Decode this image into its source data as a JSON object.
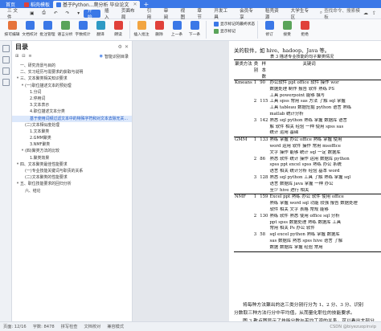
{
  "titlebar": {
    "home": "首页",
    "tabs": [
      {
        "label": "稻壳模板",
        "icon_color": "#e0413a"
      },
      {
        "label": "基于Python...爬分析 毕业论文",
        "icon_color": "#3b78e7"
      }
    ],
    "new_tab": "+"
  },
  "menubar": {
    "items": [
      "三 文件",
      "",
      "",
      "",
      "",
      "",
      "开始",
      "插入",
      "页面布局",
      "引用",
      "审阅",
      "视图",
      "章节",
      "开发工具",
      "会员专享",
      "稻壳资源",
      "大学生专区"
    ],
    "active": "开始",
    "search": "查找命令、搜索模板"
  },
  "ribbon": {
    "buttons": [
      {
        "label": "按可编辑",
        "color": "#e6733a"
      },
      {
        "label": "文档校对",
        "color": "#3b78e7"
      },
      {
        "label": "批注管理",
        "color": "#3b78e7"
      },
      {
        "label": "语言分析",
        "color": "#5aa45a"
      },
      {
        "label": "字数统计",
        "color": "#3b78e7"
      },
      {
        "label": "翻译",
        "color": "#2f9ac4"
      },
      {
        "label": "朗读",
        "color": "#e0413a"
      },
      {
        "label": "插入批注",
        "color": "#f2a541"
      },
      {
        "label": "删除",
        "color": "#e0413a"
      },
      {
        "label": "上一条",
        "color": "#3b78e7"
      },
      {
        "label": "下一条",
        "color": "#3b78e7"
      }
    ],
    "group2": [
      "显示标记的最终状态",
      "显示标记"
    ],
    "group3": [
      "修订",
      "接受",
      "拒绝"
    ]
  },
  "toc": {
    "title": "目录",
    "smart": "智能识别目录",
    "items": [
      {
        "label": "一、研究背景与目的",
        "level": 1,
        "arrow": ""
      },
      {
        "label": "二、实习经历与需要求的获取与说明",
        "level": 1,
        "arrow": ""
      },
      {
        "label": "三、文本聚类相关知识要求",
        "level": 1,
        "arrow": "▾"
      },
      {
        "label": "(一)职位描述文本的预处理",
        "level": 2,
        "arrow": "▾"
      },
      {
        "label": "1.分词",
        "level": 3,
        "arrow": ""
      },
      {
        "label": "2.停用词",
        "level": 3,
        "arrow": ""
      },
      {
        "label": "3.文本表示",
        "level": 3,
        "arrow": ""
      },
      {
        "label": "4.职位描述文本分类",
        "level": 3,
        "arrow": ""
      },
      {
        "label": "基于使用词频过滤文本中的特殊字符和对文本去除无关...",
        "level": 3,
        "arrow": "",
        "selected": true
      },
      {
        "label": "(二)文本相似度处理",
        "level": 2,
        "arrow": ""
      },
      {
        "label": "1.文本聚类",
        "level": 3,
        "arrow": ""
      },
      {
        "label": "2.GMM聚类",
        "level": 3,
        "arrow": ""
      },
      {
        "label": "3.NMF聚类",
        "level": 3,
        "arrow": ""
      },
      {
        "label": "(四)聚类方法的比较",
        "level": 2,
        "arrow": "▾"
      },
      {
        "label": "1.聚类效果",
        "level": 3,
        "arrow": ""
      },
      {
        "label": "四、文本聚类最佳性能要求",
        "level": 1,
        "arrow": "▾"
      },
      {
        "label": "(一)专业技能关键词与职责的关系",
        "level": 2,
        "arrow": ""
      },
      {
        "label": "(二)文本聚类的性能要求",
        "level": 2,
        "arrow": ""
      },
      {
        "label": "五、职位技能要求的回归分析",
        "level": 1,
        "arrow": "▾"
      },
      {
        "label": "六、结论",
        "level": 2,
        "arrow": ""
      }
    ]
  },
  "document": {
    "intro": "关的软件，如 hive、hadoop、Java 等。",
    "caption": "表 3 描述专业技能的句子聚类情况",
    "table": {
      "headers": [
        "聚类方法",
        "类别",
        "样本数",
        "关键词"
      ],
      "rows": [
        {
          "method": "Kmeans",
          "cls": "1",
          "num": "90",
          "kw": [
            "办公软件 ppt office 软件 操作 wor",
            "数据处理 制作 报告 软件 熟练 PS",
            "工具 powerpoint 能够 撰写"
          ],
          "sep": true
        },
        {
          "method": "",
          "cls": "2",
          "num": "115",
          "kw": [
            "工具 spss 常用 sas 方法 了解 sql 掌握",
            "工具 tableau 数据挖掘 python 语言 熟练",
            "matlab 统计分析"
          ],
          "sep": false
        },
        {
          "method": "",
          "cls": "3",
          "num": "142",
          "kw": [
            "熟悉 sql python 熟练 掌握 数据库 语言",
            "解 软件 相关 经验 一种 使用 spss sas",
            "统计 运用 基础"
          ],
          "sep": false
        },
        {
          "method": "GMM",
          "cls": "1",
          "num": "133",
          "kw": [
            "熟练 掌握 办公 office 熟练 掌握 使用",
            "word 运用 软件 操作 常用 msoffice",
            "文字 操作 能够 统计 sql 一定 数据库"
          ],
          "sep": true
        },
        {
          "method": "",
          "cls": "2",
          "num": "86",
          "kw": [
            "熟悉 软件 统计 操作 运用 数据库 python",
            "spss ppt excel spss 熟练 办公 系统",
            "语言 相关 统计分析 经验 基本 word"
          ],
          "sep": false
        },
        {
          "method": "",
          "cls": "3",
          "num": "128",
          "kw": [
            "熟悉 sql python 工具 了解 熟练 掌握 sql",
            "语言 数据库 java 掌握 一种 办公",
            "至少 hive 进行 相关"
          ],
          "sep": false
        },
        {
          "method": "NMF",
          "cls": "1",
          "num": "159",
          "kw": [
            "Excel ppt 熟练 办公 软件 使用 office",
            "熟练 掌握 word sql 功能 较强 报告 数据处理",
            "软件 相关 文字 表格 常规 能够"
          ],
          "sep": true
        },
        {
          "method": "",
          "cls": "2",
          "num": "130",
          "kw": [
            "熟练 软件 熟悉 使用 office sql 分析",
            "ppt spss 数据处理 熟练 数据库 工具",
            "常用 相关 Ps 办公 软件"
          ],
          "sep": false
        },
        {
          "method": "",
          "cls": "3",
          "num": "58",
          "kw": [
            "sql excel python 熟练 掌握 数据库",
            "sas 数据库 熟悉 spss hive 语言 了解",
            "数据 数据库 掌握 经验 常用"
          ],
          "sep": false,
          "last": true
        }
      ]
    },
    "para1": "将每种方法聚出的这三类分别行分为 1、2 分、3 分、识别",
    "para2": "分数取三种方法行分中平均值，从而量化职位的技能要求。",
    "para3": "图 3 散点图显示了技能分数与平均工资的关系，可以看出大部分"
  },
  "statusbar": {
    "page": "页面: 12/16",
    "words": "字数: 8478",
    "spell": "拼写检查",
    "proof": "文档校对",
    "mode": "兼容模式",
    "watermark": "CSDN @biyezuopinvip"
  }
}
